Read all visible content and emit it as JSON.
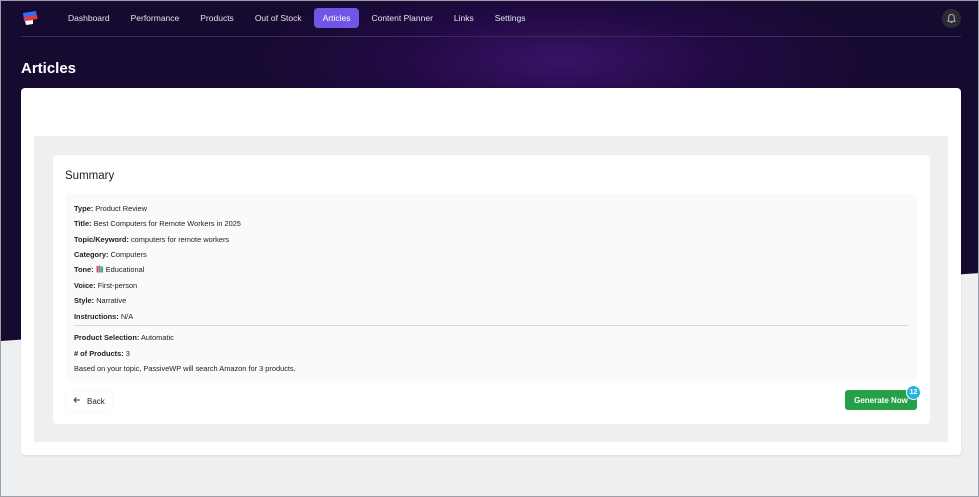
{
  "nav": {
    "items": [
      "Dashboard",
      "Performance",
      "Products",
      "Out of Stock",
      "Articles",
      "Content Planner",
      "Links",
      "Settings"
    ],
    "active_index": 4
  },
  "icons": {
    "logo": "app-logo-icon",
    "bell": "bell-icon",
    "back": "arrow-left-icon",
    "tone": "books-icon"
  },
  "page": {
    "title": "Articles"
  },
  "summary": {
    "title": "Summary",
    "fields": [
      {
        "label": "Type:",
        "value": "Product Review"
      },
      {
        "label": "Title:",
        "value": "Best Computers for Remote Workers in 2025"
      },
      {
        "label": "Topic/Keyword:",
        "value": "computers for remote workers"
      },
      {
        "label": "Category:",
        "value": "Computers"
      },
      {
        "label": "Tone:",
        "value": "Educational"
      },
      {
        "label": "Voice:",
        "value": "First-person"
      },
      {
        "label": "Style:",
        "value": "Narrative"
      },
      {
        "label": "Instructions:",
        "value": "N/A"
      }
    ],
    "product_fields": [
      {
        "label": "Product Selection:",
        "value": "Automatic"
      },
      {
        "label": "# of Products:",
        "value": "3"
      }
    ],
    "note": "Based on your topic, PassiveWP will search Amazon for 3 products."
  },
  "actions": {
    "back_label": "Back",
    "generate_label": "Generate Now",
    "generate_badge": "12"
  },
  "colors": {
    "hero_bg": "#160a30",
    "nav_active": "#6f56e6",
    "generate": "#26a047",
    "badge": "#21b6e0"
  }
}
